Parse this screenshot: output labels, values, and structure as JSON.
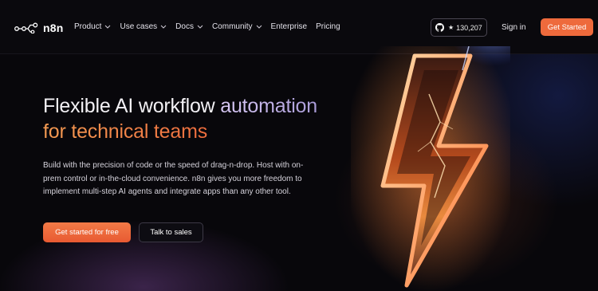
{
  "brand": {
    "name": "n8n"
  },
  "nav": {
    "items": [
      {
        "label": "Product",
        "has_dropdown": true
      },
      {
        "label": "Use cases",
        "has_dropdown": true
      },
      {
        "label": "Docs",
        "has_dropdown": true
      },
      {
        "label": "Community",
        "has_dropdown": true
      },
      {
        "label": "Enterprise",
        "has_dropdown": false
      },
      {
        "label": "Pricing",
        "has_dropdown": false
      }
    ]
  },
  "github": {
    "stars": "130,207",
    "icon": "github-icon"
  },
  "header": {
    "signin_label": "Sign in",
    "cta_label": "Get Started"
  },
  "hero": {
    "headline_white": "Flexible AI workflow ",
    "headline_accent": "automation",
    "headline_line2": "for technical teams",
    "description": "Build with the precision of code or the speed of drag-n-drop. Host with on-prem control or in-the-cloud convenience. n8n gives you more freedom to implement multi-step AI agents and integrate apps than any other tool.",
    "primary_button": "Get started for free",
    "secondary_button": "Talk to sales"
  },
  "colors": {
    "accent": "#ee6a3c",
    "background": "#08070b",
    "headline_purple": "#c4b5ee"
  }
}
